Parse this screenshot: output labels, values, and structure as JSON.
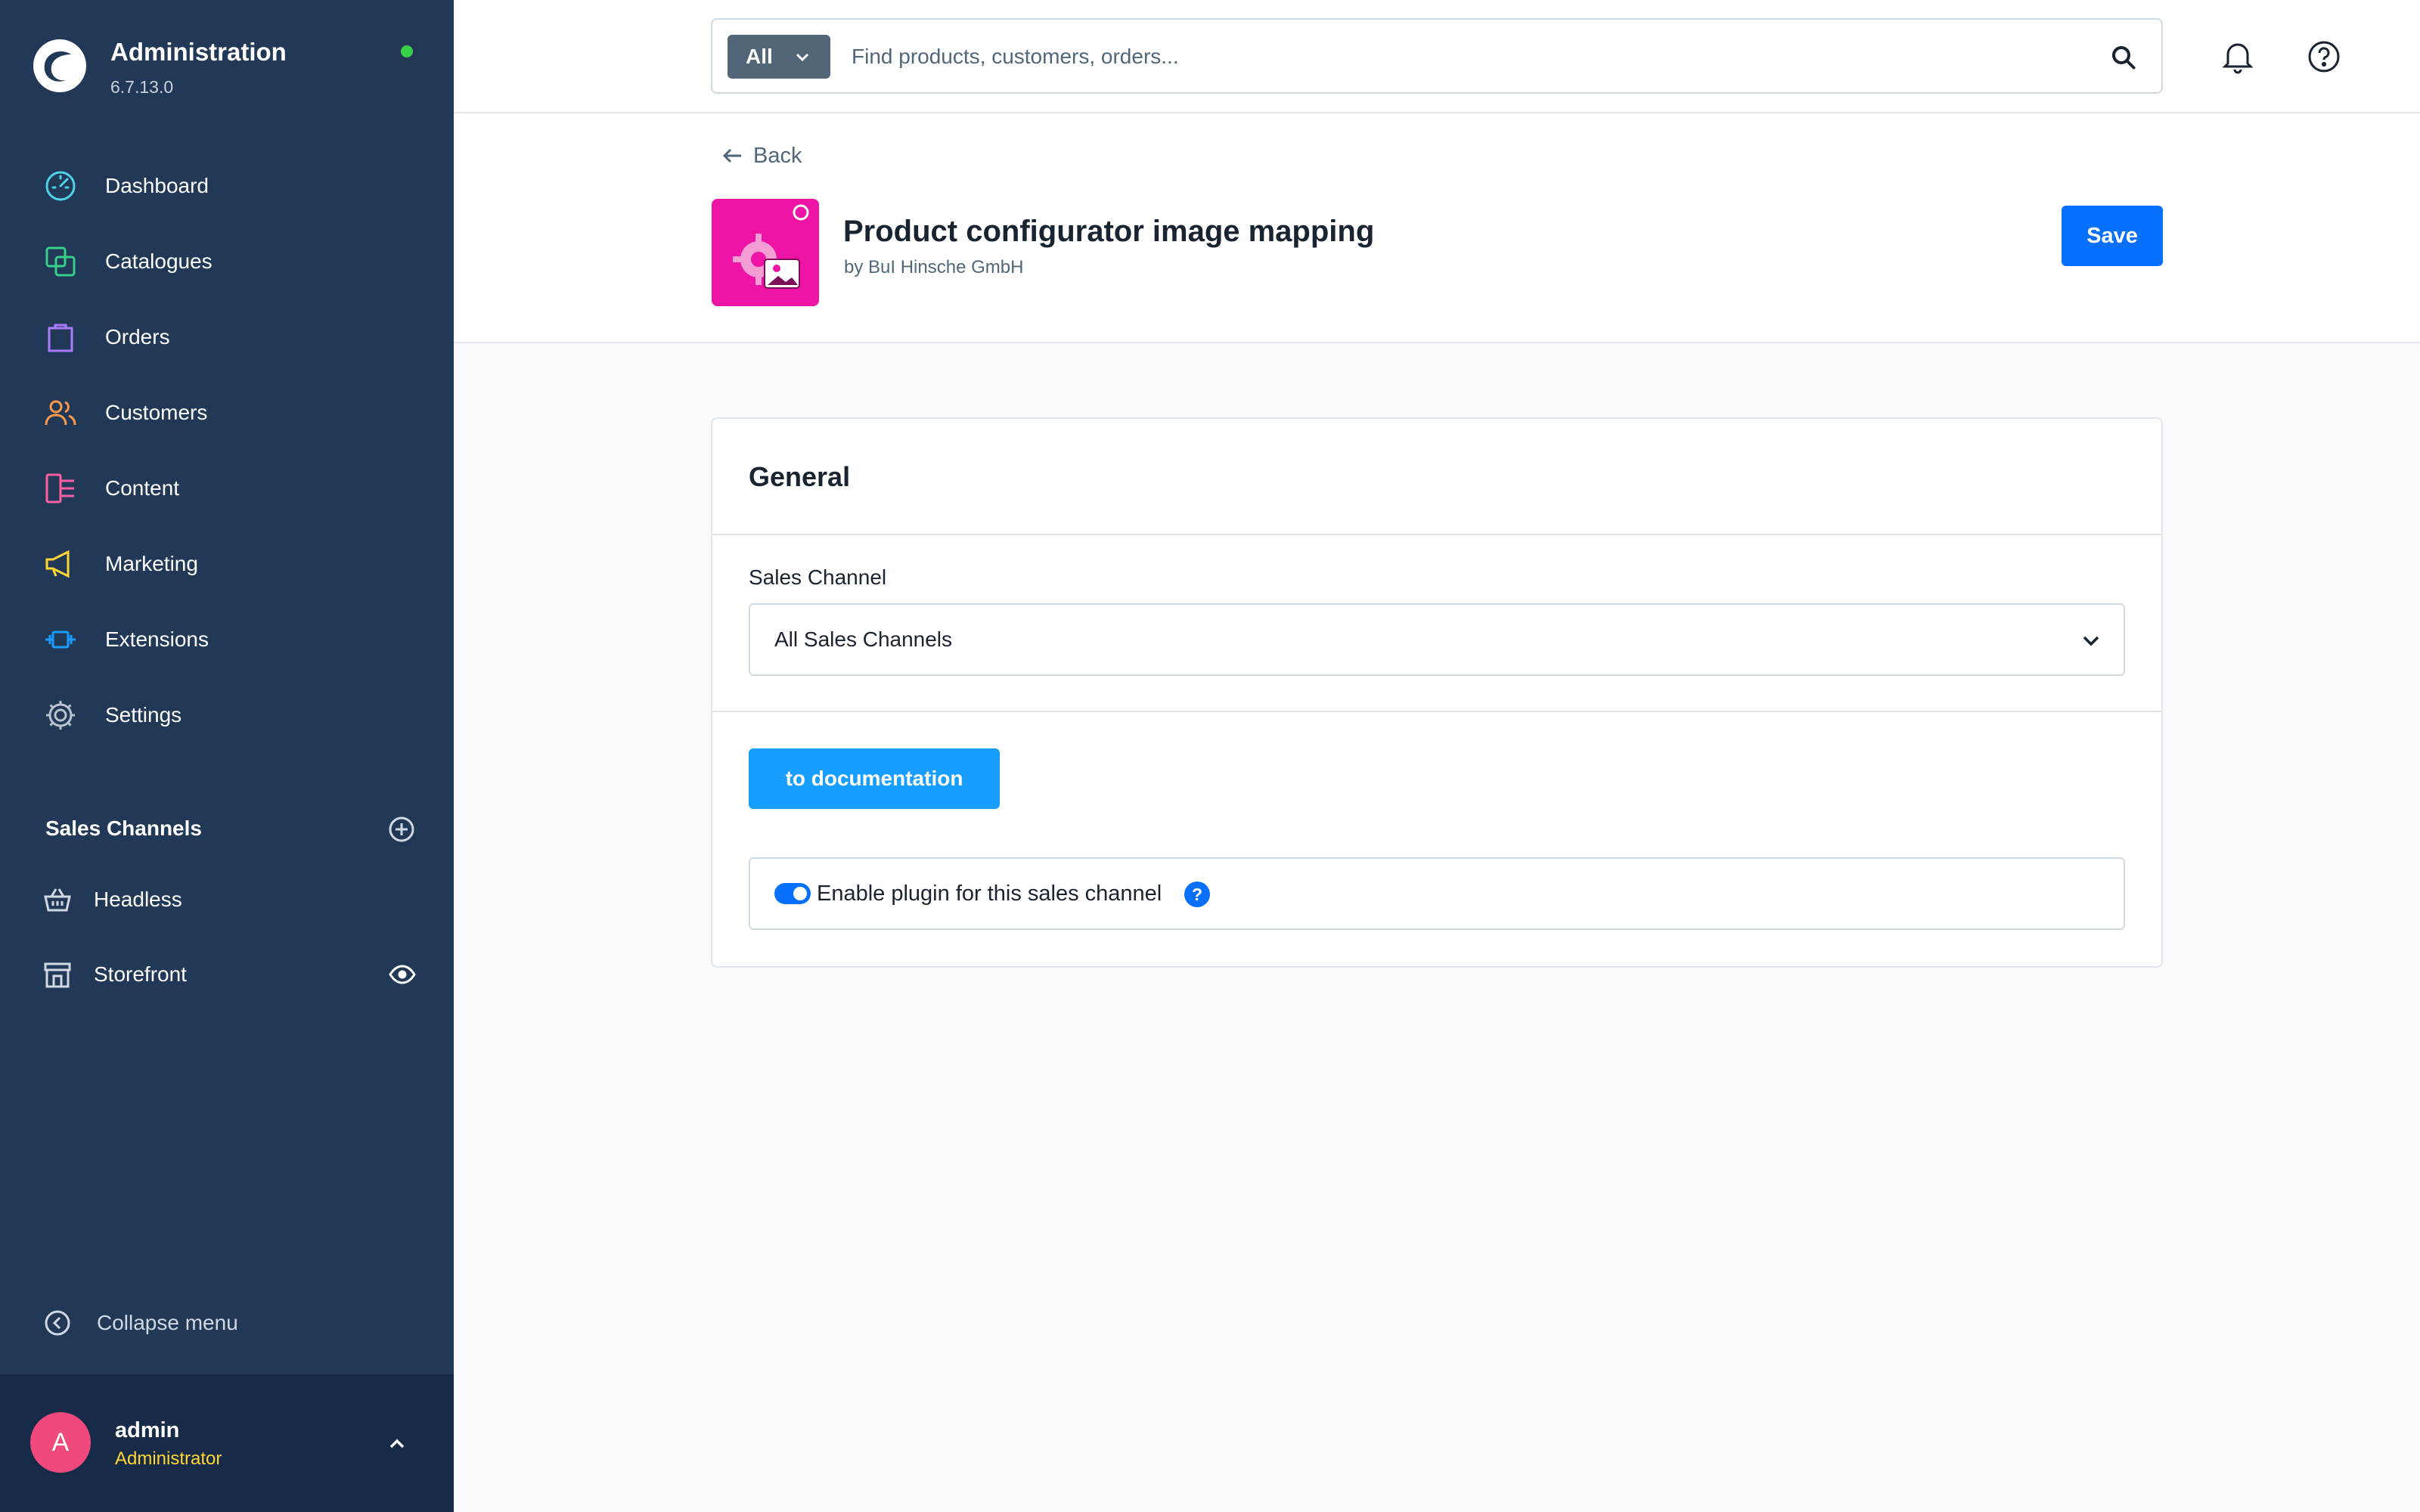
{
  "brand": {
    "title": "Administration",
    "version": "6.7.13.0"
  },
  "nav": {
    "items": [
      {
        "label": "Dashboard",
        "icon": "dashboard-icon",
        "color": "#4fd1e8"
      },
      {
        "label": "Catalogues",
        "icon": "catalogues-icon",
        "color": "#37d08a"
      },
      {
        "label": "Orders",
        "icon": "orders-icon",
        "color": "#a97cff"
      },
      {
        "label": "Customers",
        "icon": "customers-icon",
        "color": "#ff9a4a"
      },
      {
        "label": "Content",
        "icon": "content-icon",
        "color": "#ff5fa2"
      },
      {
        "label": "Marketing",
        "icon": "marketing-icon",
        "color": "#ffd633"
      },
      {
        "label": "Extensions",
        "icon": "extensions-icon",
        "color": "#189eff"
      },
      {
        "label": "Settings",
        "icon": "settings-icon",
        "color": "#b8c3cf"
      }
    ]
  },
  "sales_channels": {
    "title": "Sales Channels",
    "items": [
      {
        "label": "Headless",
        "icon": "basket-icon"
      },
      {
        "label": "Storefront",
        "icon": "storefront-icon"
      }
    ]
  },
  "collapse_label": "Collapse menu",
  "user": {
    "initial": "A",
    "name": "admin",
    "role": "Administrator"
  },
  "search": {
    "type": "All",
    "placeholder": "Find products, customers, orders..."
  },
  "header": {
    "back": "Back",
    "title": "Product configurator image mapping",
    "vendor": "by BuI Hinsche GmbH",
    "save": "Save"
  },
  "card": {
    "title": "General",
    "sales_channel_label": "Sales Channel",
    "sales_channel_value": "All Sales Channels",
    "doc_button": "to documentation",
    "toggle_label": "Enable plugin for this sales channel",
    "toggle_on": true,
    "help": "?"
  },
  "colors": {
    "accent": "#0870ff",
    "sidebar": "#213957",
    "doc_button": "#189eff",
    "plugin_icon": "#ee14a6"
  }
}
